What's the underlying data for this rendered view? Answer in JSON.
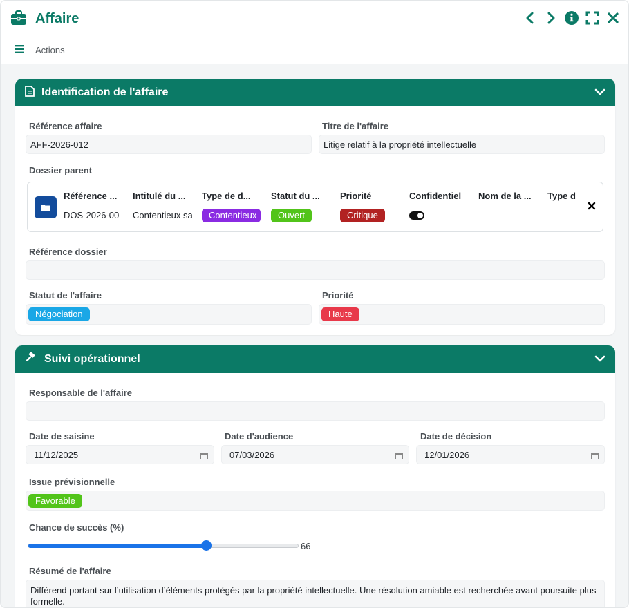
{
  "window": {
    "title": "Affaire",
    "actions_label": "Actions"
  },
  "identification": {
    "header": "Identification de l'affaire",
    "reference_label": "Référence affaire",
    "reference_value": "AFF-2026-012",
    "titre_label": "Titre de l'affaire",
    "titre_value": "Litige relatif à la propriété intellectuelle",
    "dossier_parent_label": "Dossier parent",
    "dossier_parent": {
      "columns": [
        {
          "header": "Référence ...",
          "value": "DOS-2026-00"
        },
        {
          "header": "Intitulé du ...",
          "value": "Contentieux sa"
        },
        {
          "header": "Type de d...",
          "badge": "Contentieux",
          "badge_color": "#8a2be2"
        },
        {
          "header": "Statut du ...",
          "badge": "Ouvert",
          "badge_color": "#52c41a"
        },
        {
          "header": "Priorité",
          "badge": "Critique",
          "badge_color": "#b22222"
        },
        {
          "header": "Confidentiel",
          "toggle": true
        },
        {
          "header": "Nom de la ...",
          "value": ""
        },
        {
          "header": "Type d",
          "value": ""
        }
      ]
    },
    "reference_dossier_label": "Référence dossier",
    "reference_dossier_value": "",
    "statut_label": "Statut de l'affaire",
    "statut_value": "Négociation",
    "statut_color": "#1aa7e6",
    "priorite_label": "Priorité",
    "priorite_value": "Haute",
    "priorite_color": "#e8394a"
  },
  "suivi": {
    "header": "Suivi opérationnel",
    "responsable_label": "Responsable de l'affaire",
    "responsable_value": "",
    "date_saisine_label": "Date de saisine",
    "date_saisine_value": "11/12/2025",
    "date_audience_label": "Date d'audience",
    "date_audience_value": "07/03/2026",
    "date_decision_label": "Date de décision",
    "date_decision_value": "12/01/2026",
    "issue_label": "Issue prévisionnelle",
    "issue_value": "Favorable",
    "issue_color": "#52c41a",
    "chance_label": "Chance de succès (%)",
    "chance_value": 66,
    "resume_label": "Résumé de l'affaire",
    "resume_value": "Différend portant sur l’utilisation d’éléments protégés par la propriété intellectuelle. Une résolution amiable est recherchée avant poursuite plus formelle."
  },
  "colors": {
    "brand": "#0b7a66",
    "slider": "#1a73e8"
  },
  "icons": [
    "briefcase-icon",
    "chevron-left-icon",
    "chevron-right-icon",
    "info-icon",
    "expand-icon",
    "close-icon",
    "menu-icon",
    "document-icon",
    "chevron-down-icon",
    "folder-icon",
    "gavel-icon",
    "calendar-icon"
  ]
}
